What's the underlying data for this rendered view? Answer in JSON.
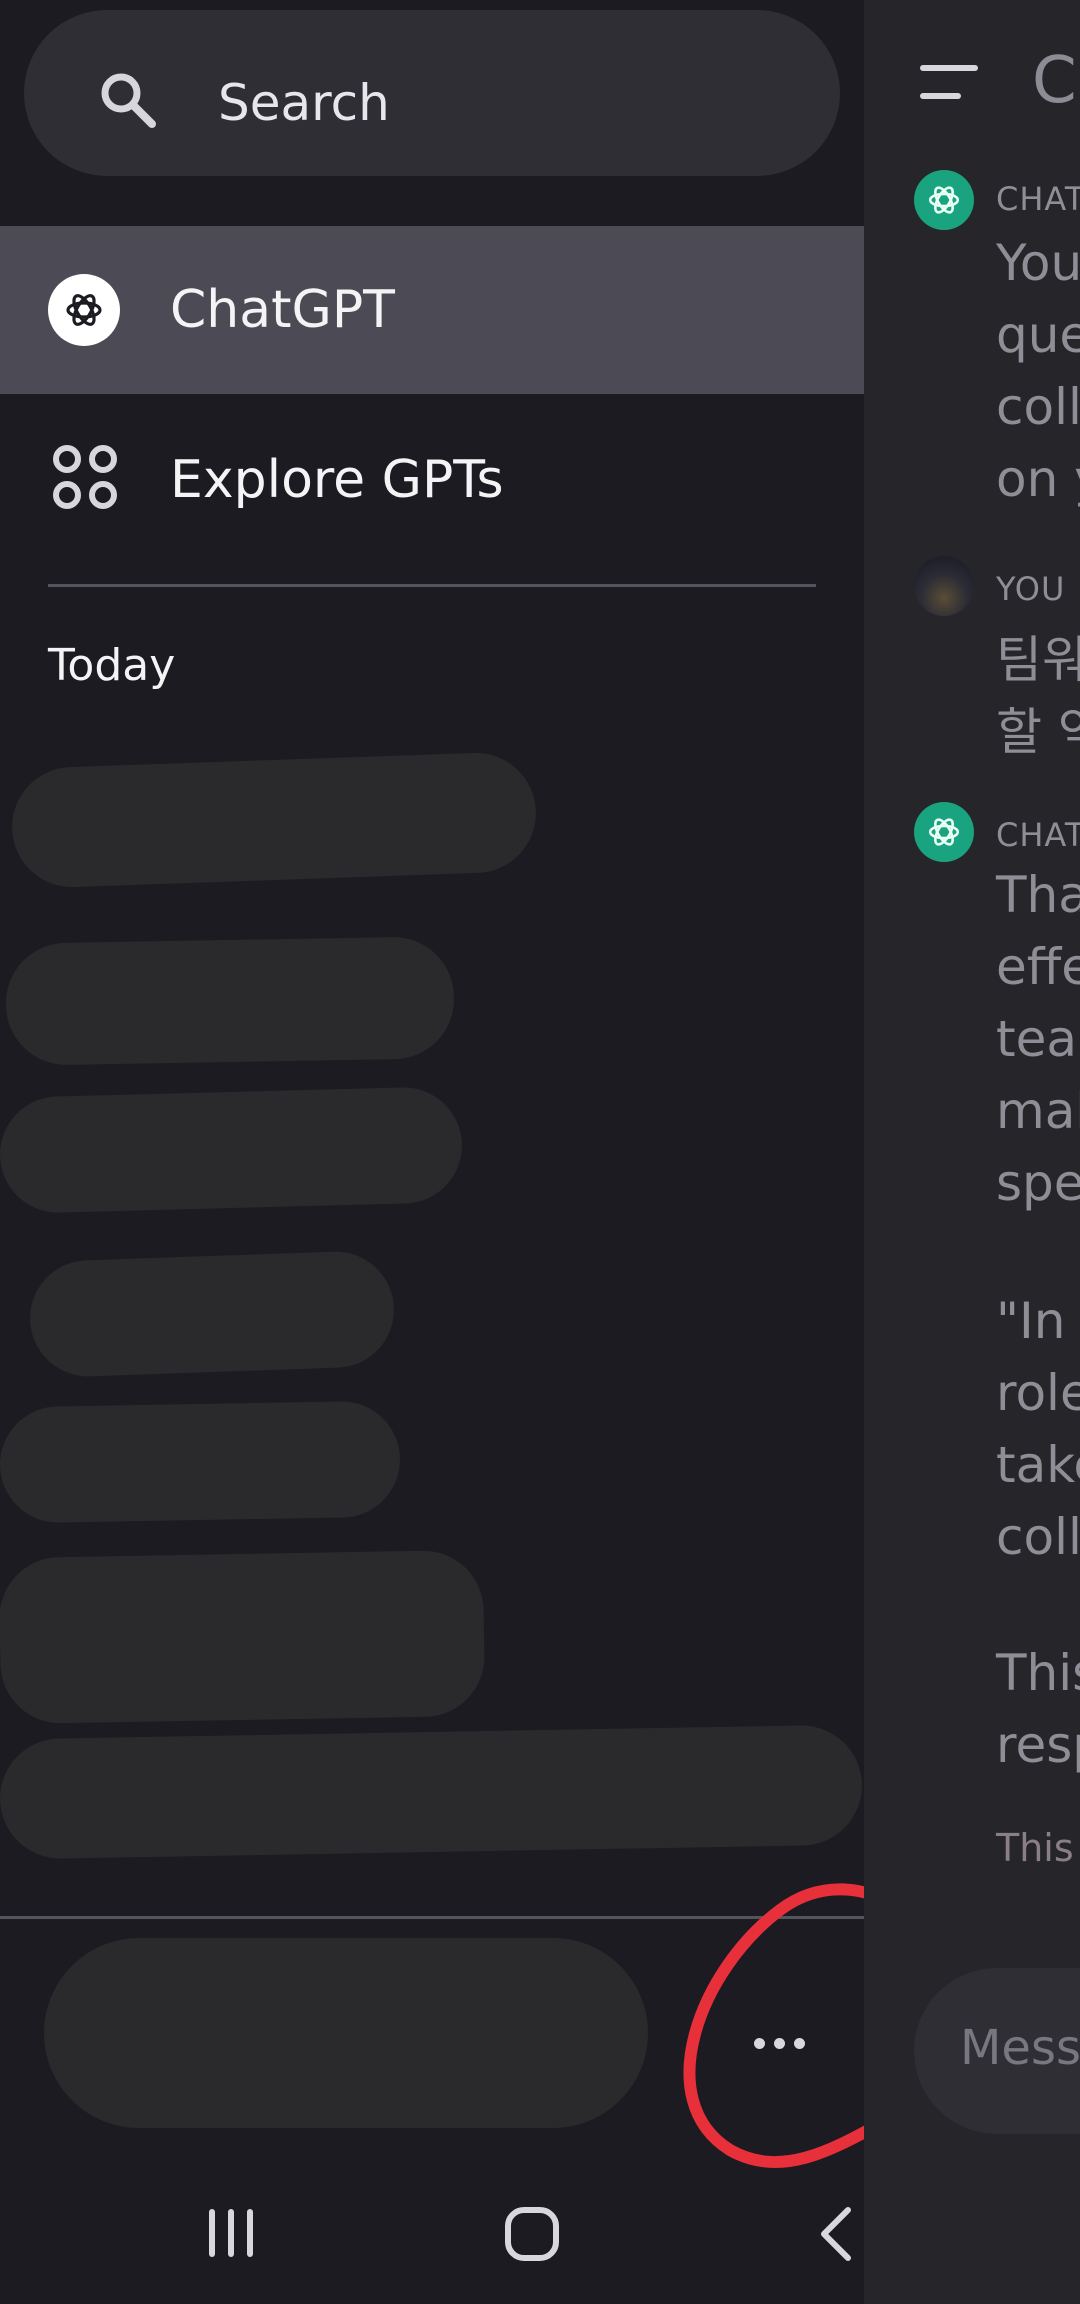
{
  "sidebar": {
    "search": {
      "label": "Search"
    },
    "nav": [
      {
        "label": "ChatGPT",
        "icon": "chatgpt-logo-icon",
        "selected": true
      },
      {
        "label": "Explore GPTs",
        "icon": "grid-icon",
        "selected": false
      }
    ],
    "section_today": "Today",
    "more_icon": "ellipsis-icon"
  },
  "main": {
    "title": "Ch",
    "messages": [
      {
        "sender": "CHAT",
        "lines": [
          "You",
          "que",
          "colla",
          "on y"
        ]
      },
      {
        "sender": "YOU",
        "lines": [
          "팀워",
          "할 역"
        ]
      },
      {
        "sender": "CHAT",
        "lines": [
          "Tha",
          "effe",
          "tean",
          "mak",
          "spe",
          "\"In y",
          "role",
          "take",
          "colla",
          "This",
          "resp"
        ],
        "note": "This"
      }
    ],
    "input_placeholder": "Mess"
  },
  "system_nav": {
    "recents_icon": "recents-icon",
    "home_icon": "home-icon",
    "back_icon": "back-icon"
  },
  "colors": {
    "sidebar_bg": "#1c1b21",
    "selected_bg": "#4c4b55",
    "chatgpt_green": "#19a37f",
    "annotation_red": "#e8303a"
  }
}
